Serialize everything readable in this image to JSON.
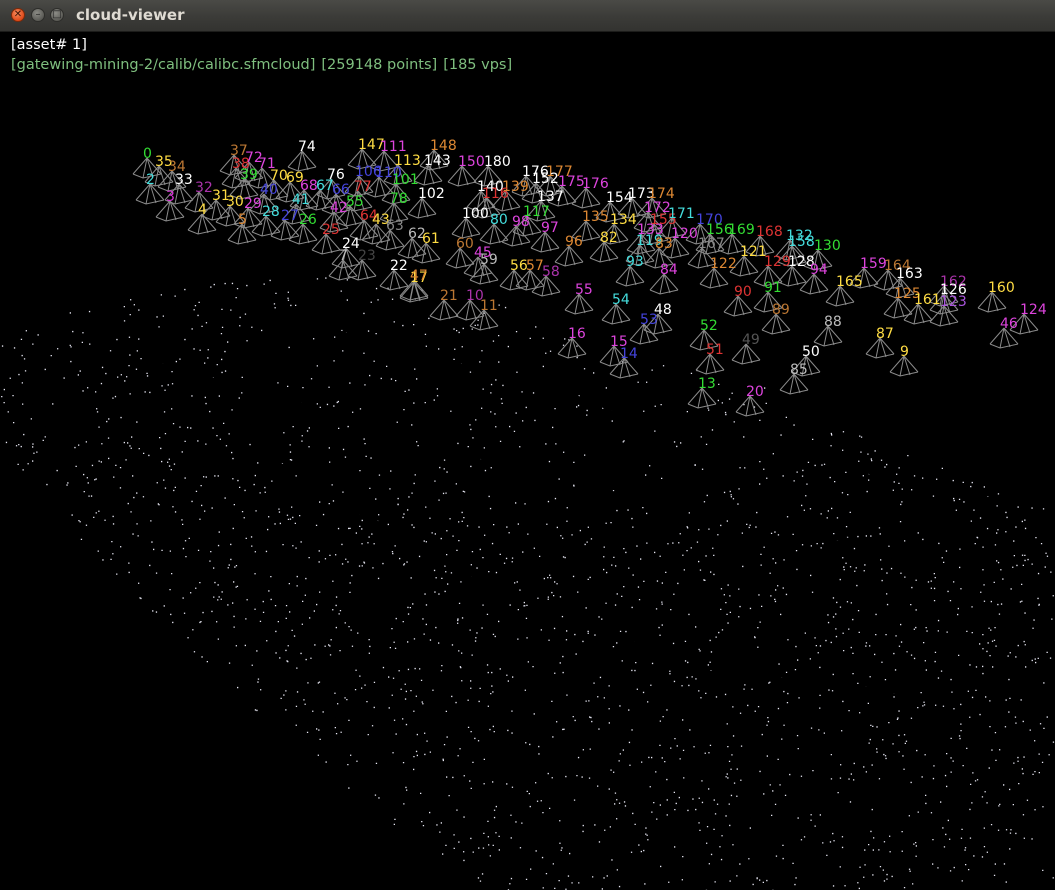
{
  "window": {
    "title": "cloud-viewer"
  },
  "overlay": {
    "asset": "[asset# 1]",
    "path": "[gatewing-mining-2/calib/calibc.sfmcloud]",
    "points": "[259148 points]",
    "vps": "[185 vps]"
  },
  "colors": {
    "info_text": "#7fbf7f",
    "point_cloud": "#e8e8f4",
    "camera_frustum": "#8a8a8a",
    "background": "#000000"
  },
  "cameras": [
    {
      "label": "0",
      "color": "#33dd33"
    },
    {
      "label": "35",
      "color": "#ffdd44"
    },
    {
      "label": "34",
      "color": "#bb7733"
    },
    {
      "label": "2",
      "color": "#44dddd"
    },
    {
      "label": "33",
      "color": "#ffffff"
    },
    {
      "label": "3",
      "color": "#dd33dd"
    },
    {
      "label": "32",
      "color": "#aa33aa"
    },
    {
      "label": "4",
      "color": "#ffdd44"
    },
    {
      "label": "31",
      "color": "#ffdd44"
    },
    {
      "label": "30",
      "color": "#ffdd44"
    },
    {
      "label": "5",
      "color": "#dd8833"
    },
    {
      "label": "29",
      "color": "#dd44dd"
    },
    {
      "label": "28",
      "color": "#44dddd"
    },
    {
      "label": "27",
      "color": "#4444dd"
    },
    {
      "label": "26",
      "color": "#33dd33"
    },
    {
      "label": "25",
      "color": "#dd3333"
    },
    {
      "label": "24",
      "color": "#ffffff"
    },
    {
      "label": "7",
      "color": "#bbbbbb"
    },
    {
      "label": "23",
      "color": "#444444"
    },
    {
      "label": "22",
      "color": "#ffffff"
    },
    {
      "label": "39",
      "color": "#33dd33"
    },
    {
      "label": "38",
      "color": "#dd3333"
    },
    {
      "label": "37",
      "color": "#bb7733"
    },
    {
      "label": "72",
      "color": "#dd44dd"
    },
    {
      "label": "71",
      "color": "#dd44dd"
    },
    {
      "label": "70",
      "color": "#ffdd44"
    },
    {
      "label": "69",
      "color": "#ffdd44"
    },
    {
      "label": "40",
      "color": "#4444dd"
    },
    {
      "label": "68",
      "color": "#dd44dd"
    },
    {
      "label": "41",
      "color": "#44dddd"
    },
    {
      "label": "67",
      "color": "#44dddd"
    },
    {
      "label": "66",
      "color": "#4444dd"
    },
    {
      "label": "42",
      "color": "#dd44dd"
    },
    {
      "label": "55",
      "color": "#33dd33"
    },
    {
      "label": "64",
      "color": "#dd3333"
    },
    {
      "label": "43",
      "color": "#ffdd44"
    },
    {
      "label": "63",
      "color": "#888888"
    },
    {
      "label": "62",
      "color": "#bbbbbb"
    },
    {
      "label": "61",
      "color": "#ffdd44"
    },
    {
      "label": "60",
      "color": "#bb7733"
    },
    {
      "label": "45",
      "color": "#dd44dd"
    },
    {
      "label": "59",
      "color": "#bbbbbb"
    },
    {
      "label": "74",
      "color": "#ffffff"
    },
    {
      "label": "76",
      "color": "#ffffff"
    },
    {
      "label": "77",
      "color": "#dd3333"
    },
    {
      "label": "78",
      "color": "#33dd33"
    },
    {
      "label": "106",
      "color": "#4444dd"
    },
    {
      "label": "110",
      "color": "#4444dd"
    },
    {
      "label": "101",
      "color": "#33dd33"
    },
    {
      "label": "102",
      "color": "#ffffff"
    },
    {
      "label": "100",
      "color": "#ffffff"
    },
    {
      "label": "80",
      "color": "#44dddd"
    },
    {
      "label": "98",
      "color": "#dd44dd"
    },
    {
      "label": "97",
      "color": "#dd44dd"
    },
    {
      "label": "96",
      "color": "#dd8833"
    },
    {
      "label": "147",
      "color": "#ffdd44"
    },
    {
      "label": "111",
      "color": "#dd44dd"
    },
    {
      "label": "113",
      "color": "#ffdd44"
    },
    {
      "label": "143",
      "color": "#ffffff"
    },
    {
      "label": "148",
      "color": "#dd8833"
    },
    {
      "label": "150",
      "color": "#dd44dd"
    },
    {
      "label": "180",
      "color": "#ffffff"
    },
    {
      "label": "176",
      "color": "#ffffff"
    },
    {
      "label": "177",
      "color": "#dd8833"
    },
    {
      "label": "152",
      "color": "#ffffff"
    },
    {
      "label": "140",
      "color": "#ffffff"
    },
    {
      "label": "139",
      "color": "#dd8833"
    },
    {
      "label": "116",
      "color": "#dd3333"
    },
    {
      "label": "137",
      "color": "#ffffff"
    },
    {
      "label": "117",
      "color": "#33dd33"
    },
    {
      "label": "135",
      "color": "#dd8833"
    },
    {
      "label": "134",
      "color": "#ffdd44"
    },
    {
      "label": "133",
      "color": "#dd44dd"
    },
    {
      "label": "119",
      "color": "#44dddd"
    },
    {
      "label": "83",
      "color": "#dd8833"
    },
    {
      "label": "82",
      "color": "#ffdd44"
    },
    {
      "label": "154",
      "color": "#ffffff"
    },
    {
      "label": "173",
      "color": "#ffffff"
    },
    {
      "label": "174",
      "color": "#dd8833"
    },
    {
      "label": "175",
      "color": "#dd44dd"
    },
    {
      "label": "176",
      "color": "#dd44dd"
    },
    {
      "label": "172",
      "color": "#dd44dd"
    },
    {
      "label": "155",
      "color": "#dd3333"
    },
    {
      "label": "171",
      "color": "#44dddd"
    },
    {
      "label": "170",
      "color": "#4444dd"
    },
    {
      "label": "156",
      "color": "#33dd33"
    },
    {
      "label": "169",
      "color": "#33dd33"
    },
    {
      "label": "168",
      "color": "#dd3333"
    },
    {
      "label": "132",
      "color": "#44dddd"
    },
    {
      "label": "120",
      "color": "#dd44dd"
    },
    {
      "label": "167",
      "color": "#888888"
    },
    {
      "label": "158",
      "color": "#44dddd"
    },
    {
      "label": "130",
      "color": "#33dd33"
    },
    {
      "label": "121",
      "color": "#ffdd44"
    },
    {
      "label": "129",
      "color": "#dd3333"
    },
    {
      "label": "128",
      "color": "#ffffff"
    },
    {
      "label": "94",
      "color": "#dd44dd"
    },
    {
      "label": "93",
      "color": "#44dddd"
    },
    {
      "label": "84",
      "color": "#dd44dd"
    },
    {
      "label": "122",
      "color": "#dd8833"
    },
    {
      "label": "165",
      "color": "#ffdd44"
    },
    {
      "label": "159",
      "color": "#dd44dd"
    },
    {
      "label": "164",
      "color": "#bb7733"
    },
    {
      "label": "163",
      "color": "#ffffff"
    },
    {
      "label": "162",
      "color": "#aa33aa"
    },
    {
      "label": "160",
      "color": "#ffdd44"
    },
    {
      "label": "126",
      "color": "#ffffff"
    },
    {
      "label": "125",
      "color": "#dd8833"
    },
    {
      "label": "123",
      "color": "#aa55dd"
    },
    {
      "label": "161",
      "color": "#ffdd44"
    },
    {
      "label": "124",
      "color": "#dd44dd"
    },
    {
      "label": "46",
      "color": "#dd44dd"
    },
    {
      "label": "57",
      "color": "#dd8833"
    },
    {
      "label": "58",
      "color": "#aa33aa"
    },
    {
      "label": "56",
      "color": "#ffdd44"
    },
    {
      "label": "55",
      "color": "#dd44dd"
    },
    {
      "label": "54",
      "color": "#44dddd"
    },
    {
      "label": "48",
      "color": "#ffffff"
    },
    {
      "label": "53",
      "color": "#4444dd"
    },
    {
      "label": "52",
      "color": "#33dd33"
    },
    {
      "label": "49",
      "color": "#555555"
    },
    {
      "label": "51",
      "color": "#dd3333"
    },
    {
      "label": "50",
      "color": "#ffffff"
    },
    {
      "label": "85",
      "color": "#bbbbbb"
    },
    {
      "label": "91",
      "color": "#33dd33"
    },
    {
      "label": "90",
      "color": "#dd3333"
    },
    {
      "label": "89",
      "color": "#bb7733"
    },
    {
      "label": "88",
      "color": "#bbbbbb"
    },
    {
      "label": "87",
      "color": "#ffdd44"
    },
    {
      "label": "9",
      "color": "#ffdd44"
    },
    {
      "label": "10",
      "color": "#aa33aa"
    },
    {
      "label": "11",
      "color": "#bb7733"
    },
    {
      "label": "17",
      "color": "#ffdd44"
    },
    {
      "label": "16",
      "color": "#dd44dd"
    },
    {
      "label": "15",
      "color": "#dd44dd"
    },
    {
      "label": "14",
      "color": "#4444dd"
    },
    {
      "label": "13",
      "color": "#33dd33"
    },
    {
      "label": "20",
      "color": "#dd44dd"
    },
    {
      "label": "21",
      "color": "#bb7733"
    },
    {
      "label": "47",
      "color": "#dd8833"
    }
  ]
}
